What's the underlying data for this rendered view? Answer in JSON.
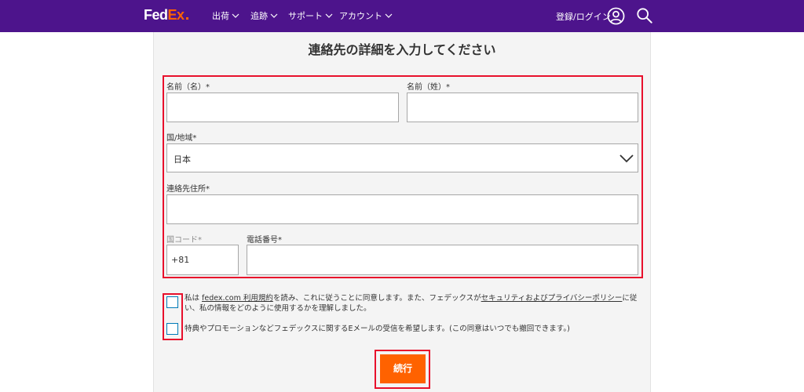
{
  "header": {
    "logo": {
      "fed": "Fed",
      "ex": "Ex"
    },
    "nav": [
      {
        "label": "出荷"
      },
      {
        "label": "追跡"
      },
      {
        "label": "サポート"
      },
      {
        "label": "アカウント"
      }
    ],
    "login_label": "登録/ログイン",
    "icons": [
      "user-icon",
      "search-icon",
      "chevron-down-icon"
    ]
  },
  "form": {
    "title": "連絡先の詳細を入力してください",
    "first_name_label": "名前（名）*",
    "last_name_label": "名前（姓）*",
    "first_name_value": "",
    "last_name_value": "",
    "country_label": "国/地域*",
    "country_value": "日本",
    "address_label": "連絡先住所*",
    "address_value": "",
    "country_code_label": "国コード*",
    "country_code_value": "+81",
    "phone_label": "電話番号*",
    "phone_value": ""
  },
  "consent": {
    "terms_prefix": "私は ",
    "terms_link": "fedex.com 利用規約",
    "terms_middle": "を読み、これに従うことに同意します。また、フェデックスが",
    "privacy_link": "セキュリティおよびプライバシーポリシー",
    "terms_suffix_line1": "に従",
    "terms_line2": "い、私の情報をどのように使用するかを理解しました。",
    "terms_checked": false,
    "marketing_text": "特典やプロモーションなどフェデックスに関するEメールの受信を希望します。(この同意はいつでも撤回できます。)",
    "marketing_checked": false
  },
  "continue_label": "続行",
  "colors": {
    "brand_purple": "#4d148c",
    "brand_orange": "#ff6200",
    "highlight_red": "#e8102c",
    "checkbox_blue": "#007ab7"
  }
}
